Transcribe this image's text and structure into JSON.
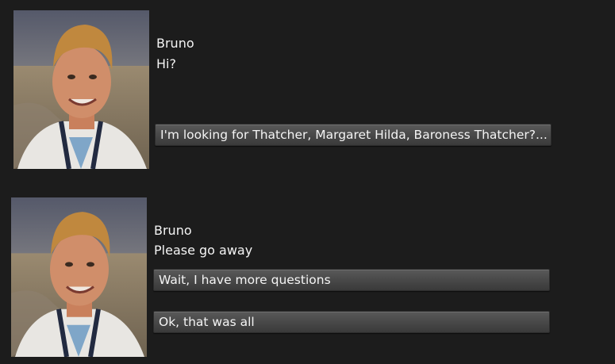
{
  "conversation": [
    {
      "speaker": "Bruno",
      "line": "Hi?",
      "portrait_icon": "npc-portrait",
      "choices": [
        "I'm looking for Thatcher, Margaret Hilda, Baroness Thatcher?..."
      ]
    },
    {
      "speaker": "Bruno",
      "line": "Please go away",
      "portrait_icon": "npc-portrait",
      "choices": [
        "Wait, I have more questions",
        "Ok, that was all"
      ]
    }
  ],
  "colors": {
    "background": "#1c1c1c",
    "text": "#f4f4f4",
    "button_top": "#5a5a5a",
    "button_bottom": "#3a3a3a"
  }
}
